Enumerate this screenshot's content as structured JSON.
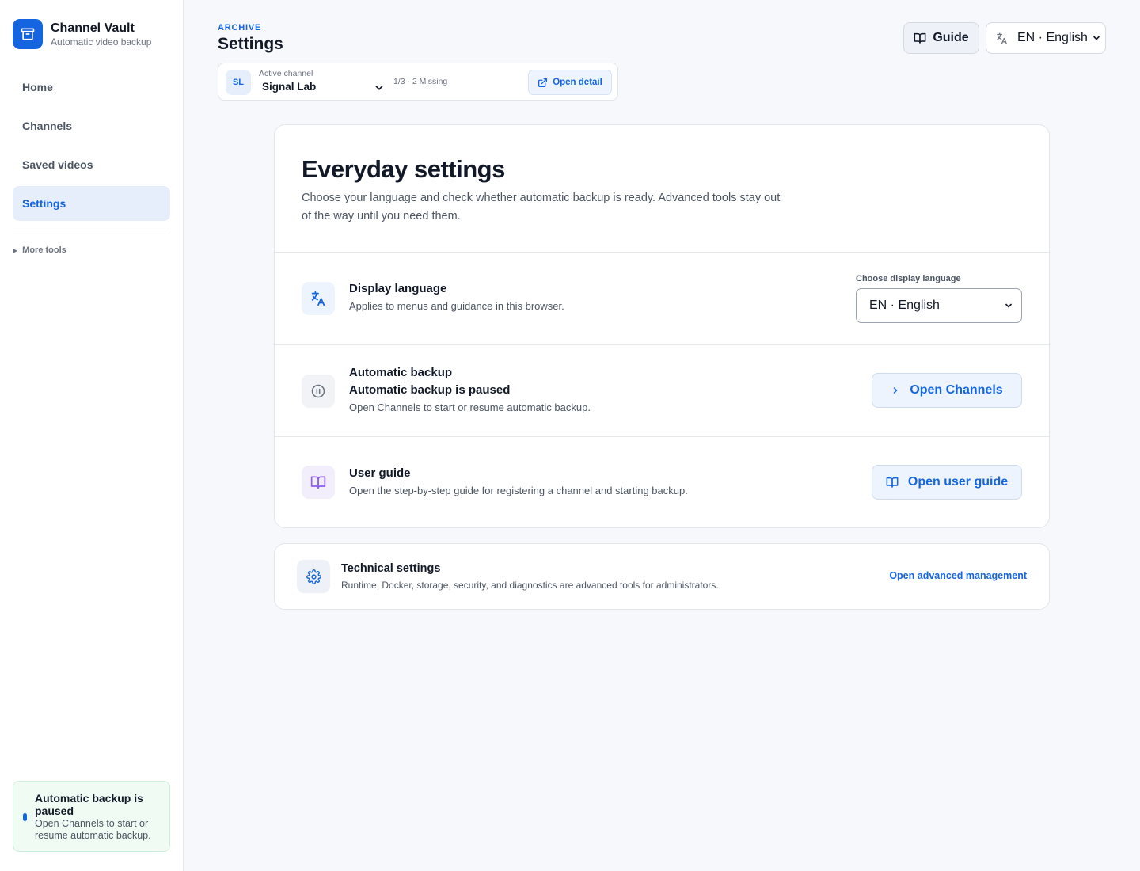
{
  "brand": {
    "name": "Channel Vault",
    "subtitle": "Automatic video backup"
  },
  "nav": {
    "items": [
      {
        "label": "Home"
      },
      {
        "label": "Channels"
      },
      {
        "label": "Saved videos"
      },
      {
        "label": "Settings",
        "active": true
      }
    ],
    "more_tools": "More tools"
  },
  "sidebar_status": {
    "title": "Automatic backup is paused",
    "description": "Open Channels to start or resume automatic backup."
  },
  "header": {
    "eyebrow": "ARCHIVE",
    "title": "Settings",
    "guide_label": "Guide",
    "language_value": "EN · English"
  },
  "channel_bar": {
    "avatar": "SL",
    "label": "Active channel",
    "name": "Signal Lab",
    "count": "1/3 · 2 Missing",
    "open_detail": "Open detail"
  },
  "main": {
    "title": "Everyday settings",
    "description": "Choose your language and check whether automatic backup is ready. Advanced tools stay out of the way until you need them.",
    "language_row": {
      "title": "Display language",
      "description": "Applies to menus and guidance in this browser.",
      "select_label": "Choose display language",
      "select_value": "EN · English"
    },
    "backup_row": {
      "title": "Automatic backup",
      "status": "Automatic backup is paused",
      "description": "Open Channels to start or resume automatic backup.",
      "button": "Open Channels"
    },
    "guide_row": {
      "title": "User guide",
      "description": "Open the step-by-step guide for registering a channel and starting backup.",
      "button": "Open user guide"
    }
  },
  "technical": {
    "title": "Technical settings",
    "description": "Runtime, Docker, storage, security, and diagnostics are advanced tools for administrators.",
    "link": "Open advanced management"
  },
  "colors": {
    "accent": "#1565e0",
    "accent_soft": "#e6eefc",
    "status_bg": "#f0fbf4",
    "guide_icon_bg": "#f3eefb",
    "guide_icon": "#8b5cf6"
  }
}
